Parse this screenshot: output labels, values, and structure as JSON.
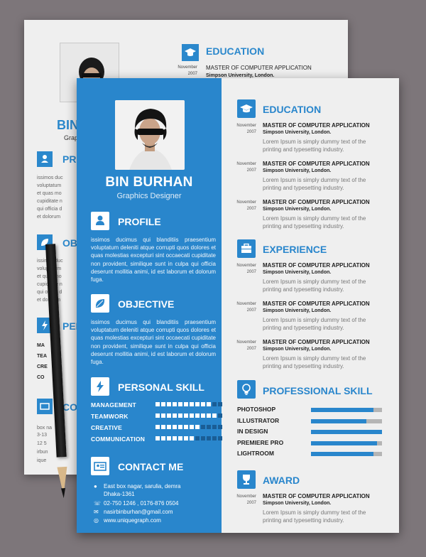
{
  "back_sheet": {
    "section_title": "EDUCATION",
    "entry": {
      "month": "November",
      "year": "2007",
      "title": "MASTER OF COMPUTER APPLICATION",
      "org": "Simpson University, London."
    },
    "fragments": [
      "BIN",
      "Graphics",
      "PRO",
      "OBJ",
      "PER",
      "CO"
    ],
    "text_lines": [
      "issimos duc",
      "voluptatum",
      "et quas mo",
      "cupiditate n",
      "qui officia d",
      "et dolorum",
      "issimos duc",
      "voluptatum",
      "et quas mo",
      "cupiditate n",
      "qui officia d",
      "et dolorum",
      "MA",
      "TEA",
      "CRE",
      "CO",
      "box na",
      "3-13",
      "12 5",
      "irbun",
      "ique"
    ]
  },
  "profile": {
    "name": "BIN BURHAN",
    "role": "Graphics Designer"
  },
  "left": {
    "profile_title": "PROFILE",
    "profile_text": "issimos ducimus qui blanditiis praesentium voluptatum deleniti atque corrupti quos dolores et quas molestias excepturi sint occaecati cupiditate non provident, similique sunt in culpa qui officia deserunt mollitia animi, id est laborum et dolorum fuga.",
    "objective_title": "OBJECTIVE",
    "objective_text": "issimos ducimus qui blanditiis praesentium voluptatum deleniti atque corrupti quos dolores et quas molestias excepturi sint occaecati cupiditate non provident, similique sunt in culpa qui officia deserunt mollitia animi, id est laborum et dolorum fuga.",
    "personal_skill_title": "PERSONAL SKILL",
    "skills": [
      {
        "label": "MANAGEMENT",
        "level": 10,
        "max": 12
      },
      {
        "label": "TEAMWORK",
        "level": 11,
        "max": 12
      },
      {
        "label": "CREATIVE",
        "level": 8,
        "max": 12
      },
      {
        "label": "COMMUNICATION",
        "level": 7,
        "max": 12
      }
    ],
    "contact_title": "CONTACT ME",
    "contact": {
      "address_line1": "East box nagar, sarulia, demra",
      "address_line2": "Dhaka-1361",
      "phone": "02-750 1246 , 0176-876 0504",
      "email": "nasirbinburhan@gmail.com",
      "web": "www.uniquegraph.com"
    }
  },
  "right": {
    "education_title": "EDUCATION",
    "education": [
      {
        "month": "November",
        "year": "2007",
        "title": "MASTER OF COMPUTER APPLICATION",
        "org": "Simpson University, London.",
        "desc": "Lorem Ipsum is simply dummy text of the printing and typesetting industry."
      },
      {
        "month": "November",
        "year": "2007",
        "title": "MASTER OF COMPUTER APPLICATION",
        "org": "Simpson University, London.",
        "desc": "Lorem Ipsum is simply dummy text of the printing and typesetting industry."
      },
      {
        "month": "November",
        "year": "2007",
        "title": "MASTER OF COMPUTER APPLICATION",
        "org": "Simpson University, London.",
        "desc": "Lorem Ipsum is simply dummy text of the printing and typesetting industry."
      }
    ],
    "experience_title": "EXPERIENCE",
    "experience": [
      {
        "month": "November",
        "year": "2007",
        "title": "MASTER OF COMPUTER APPLICATION",
        "org": "Simpson University, London.",
        "desc": "Lorem Ipsum is simply dummy text of the printing and typesetting industry."
      },
      {
        "month": "November",
        "year": "2007",
        "title": "MASTER OF COMPUTER APPLICATION",
        "org": "Simpson University, London.",
        "desc": "Lorem Ipsum is simply dummy text of the printing and typesetting industry."
      },
      {
        "month": "November",
        "year": "2007",
        "title": "MASTER OF COMPUTER APPLICATION",
        "org": "Simpson University, London.",
        "desc": "Lorem Ipsum is simply dummy text of the printing and typesetting industry."
      }
    ],
    "professional_skill_title": "PROFESSIONAL SKILL",
    "professional_skills": [
      {
        "label": "PHOTOSHOP",
        "percent": 88
      },
      {
        "label": "ILLUSTRATOR",
        "percent": 78
      },
      {
        "label": "IN DESIGN",
        "percent": 100
      },
      {
        "label": "PREMIERE PRO",
        "percent": 93
      },
      {
        "label": "LIGHTROOM",
        "percent": 88
      }
    ],
    "award_title": "AWARD",
    "award": {
      "month": "November",
      "year": "2007",
      "title": "MASTER OF COMPUTER APPLICATION",
      "org": "Simpson University, London.",
      "desc": "Lorem Ipsum is simply dummy text of the printing and typesetting industry."
    }
  },
  "colors": {
    "accent": "#2986cc",
    "background": "#7d767a",
    "paper": "#efefef",
    "dot_off": "#1a5d95",
    "bar_track": "#b5b5b5"
  },
  "icons": {
    "education": "graduation-cap-icon",
    "experience": "briefcase-icon",
    "professional_skill": "lightbulb-icon",
    "award": "trophy-icon",
    "profile": "person-icon",
    "objective": "leaf-icon",
    "personal_skill": "lightning-icon",
    "contact": "id-card-icon"
  }
}
